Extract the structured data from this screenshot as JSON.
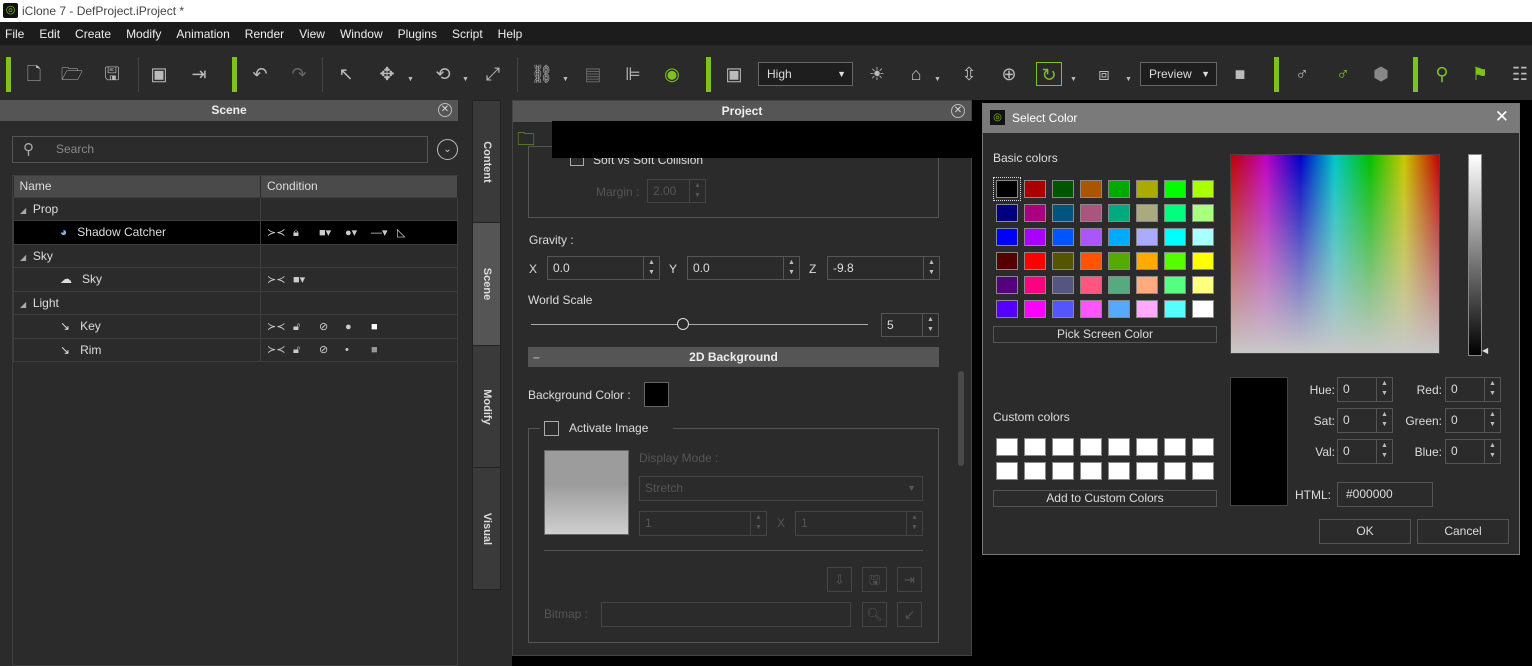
{
  "window": {
    "title": "iClone 7 - DefProject.iProject *"
  },
  "menu": [
    "File",
    "Edit",
    "Create",
    "Modify",
    "Animation",
    "Render",
    "View",
    "Window",
    "Plugins",
    "Script",
    "Help"
  ],
  "toolbar": {
    "quality_select": "High",
    "preview_select": "Preview",
    "accent_color": "#7fc21b"
  },
  "scene_panel": {
    "title": "Scene",
    "search_placeholder": "Search",
    "columns": [
      "Name",
      "Condition"
    ],
    "rows": [
      {
        "label": "Prop",
        "type": "group"
      },
      {
        "label": "Shadow Catcher",
        "type": "item",
        "selected": true
      },
      {
        "label": "Sky",
        "type": "group"
      },
      {
        "label": "Sky",
        "type": "item"
      },
      {
        "label": "Light",
        "type": "group"
      },
      {
        "label": "Key",
        "type": "item"
      },
      {
        "label": "Rim",
        "type": "item"
      }
    ]
  },
  "side_tabs": [
    "Content",
    "Scene",
    "Modify",
    "Visual"
  ],
  "project_panel": {
    "title": "Project",
    "soft_collision_label": "Soft vs Soft Collision",
    "margin_label": "Margin :",
    "margin_value": "2.00",
    "gravity_label": "Gravity :",
    "gravity": {
      "x_label": "X",
      "x": "0.0",
      "y_label": "Y",
      "y": "0.0",
      "z_label": "Z",
      "z": "-9.8"
    },
    "world_scale_label": "World Scale",
    "world_scale_value": "5",
    "world_scale_fraction": 0.45,
    "section_2d_bg": "2D Background",
    "background_color_label": "Background Color :",
    "background_color": "#000000",
    "activate_image_label": "Activate Image",
    "display_mode_label": "Display Mode :",
    "display_mode_value": "Stretch",
    "tile_x": "1",
    "tile_sep": "X",
    "tile_y": "1",
    "bitmap_label": "Bitmap :"
  },
  "color_dialog": {
    "title": "Select Color",
    "basic_colors_label": "Basic colors",
    "basic_colors": [
      "#000000",
      "#aa0000",
      "#005500",
      "#aa5500",
      "#00aa00",
      "#aaaa00",
      "#00ff00",
      "#aaff00",
      "#00007f",
      "#aa007f",
      "#00557f",
      "#aa557f",
      "#00aa7f",
      "#aaaa7f",
      "#00ff7f",
      "#aaff7f",
      "#0000ff",
      "#aa00ff",
      "#0055ff",
      "#aa55ff",
      "#00aaff",
      "#aaaaff",
      "#00ffff",
      "#aaffff",
      "#550000",
      "#ff0000",
      "#555500",
      "#ff5500",
      "#55aa00",
      "#ffaa00",
      "#55ff00",
      "#ffff00",
      "#55007f",
      "#ff007f",
      "#55557f",
      "#ff557f",
      "#55aa7f",
      "#ffaa7f",
      "#55ff7f",
      "#ffff7f",
      "#5500ff",
      "#ff00ff",
      "#5555ff",
      "#ff55ff",
      "#55aaff",
      "#ffaaff",
      "#55ffff",
      "#ffffff"
    ],
    "pick_screen_color": "Pick Screen Color",
    "custom_colors_label": "Custom colors",
    "add_custom": "Add to Custom Colors",
    "hue_label": "Hue:",
    "hue": "0",
    "sat_label": "Sat:",
    "sat": "0",
    "val_label": "Val:",
    "val": "0",
    "red_label": "Red:",
    "red": "0",
    "green_label": "Green:",
    "green": "0",
    "blue_label": "Blue:",
    "blue": "0",
    "html_label": "HTML:",
    "html": "#000000",
    "ok": "OK",
    "cancel": "Cancel"
  }
}
